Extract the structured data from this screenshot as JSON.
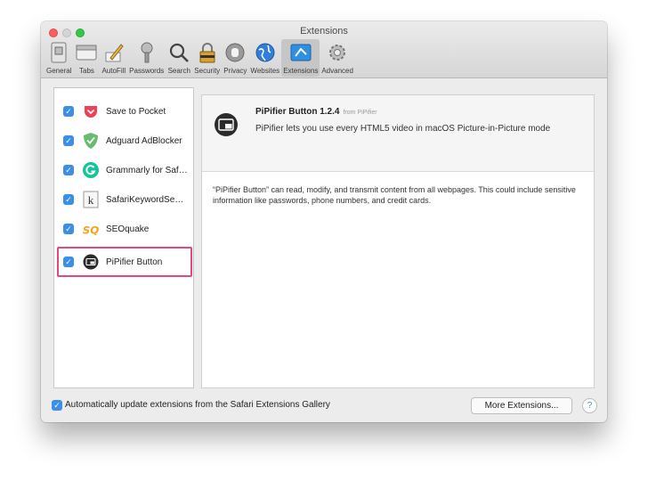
{
  "window": {
    "title": "Extensions"
  },
  "toolbar": {
    "items": [
      {
        "label": "General",
        "icon": "general-icon"
      },
      {
        "label": "Tabs",
        "icon": "tabs-icon"
      },
      {
        "label": "AutoFill",
        "icon": "autofill-icon"
      },
      {
        "label": "Passwords",
        "icon": "passwords-icon"
      },
      {
        "label": "Search",
        "icon": "search-icon"
      },
      {
        "label": "Security",
        "icon": "security-icon"
      },
      {
        "label": "Privacy",
        "icon": "privacy-icon"
      },
      {
        "label": "Websites",
        "icon": "websites-icon"
      },
      {
        "label": "Extensions",
        "icon": "extensions-icon",
        "active": true
      },
      {
        "label": "Advanced",
        "icon": "advanced-icon"
      }
    ]
  },
  "extensions": [
    {
      "name": "Save to Pocket",
      "enabled": true,
      "icon": "pocket-icon"
    },
    {
      "name": "Adguard AdBlocker",
      "enabled": true,
      "icon": "adguard-icon"
    },
    {
      "name": "Grammarly for Safari",
      "enabled": true,
      "icon": "grammarly-icon"
    },
    {
      "name": "SafariKeywordSearch",
      "enabled": true,
      "icon": "keyword-search-icon"
    },
    {
      "name": "SEOquake",
      "enabled": true,
      "icon": "seoquake-icon"
    },
    {
      "name": "PiPifier Button",
      "enabled": true,
      "icon": "pipifier-icon",
      "selected": true
    }
  ],
  "detail": {
    "title": "PiPifier Button 1.2.4",
    "from": "from PiPifier",
    "description": "PiPifier lets you use every HTML5 video in macOS Picture-in-Picture mode",
    "permissions": "“PiPifier Button” can read, modify, and transmit content from all webpages. This could include sensitive information like passwords, phone numbers, and credit cards."
  },
  "footer": {
    "auto_update_label": "Automatically update extensions from the Safari Extensions Gallery",
    "auto_update_checked": true,
    "more_button": "More Extensions...",
    "help": "?"
  },
  "colors": {
    "checkbox": "#3b8eea",
    "highlight": "#e8477a",
    "pocket": "#ef4056",
    "adguard": "#68bc71",
    "grammarly": "#15c39a",
    "seoquake": "#f6a21a"
  }
}
